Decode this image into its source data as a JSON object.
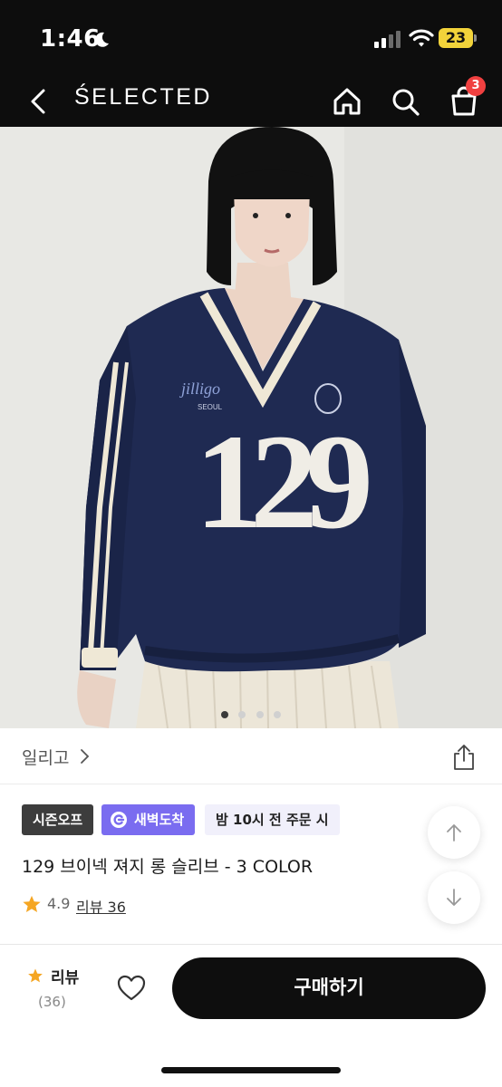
{
  "status_bar": {
    "time": "1:46",
    "battery_level": "23",
    "icons": [
      "moon-icon",
      "signal-icon",
      "wifi-icon",
      "battery-icon"
    ],
    "battery_color": "#f2d33a"
  },
  "nav": {
    "brand": "ŚELECTED",
    "cart_count": "3",
    "icons": [
      "back-arrow-icon",
      "home-icon",
      "search-icon",
      "shopping-bag-icon"
    ],
    "badge_color": "#f04040"
  },
  "hero": {
    "slide_count": 4,
    "active_slide": 1
  },
  "product": {
    "brand_name": "일리고",
    "tags": {
      "season": "시즌오프",
      "dawn_delivery": "새벽도착",
      "delivery_note": "밤 10시 전 주문 시"
    },
    "title": "129 브이넥 져지 롱 슬리브 - 3 COLOR",
    "rating": "4.9",
    "review_link": "리뷰 36",
    "accent_color": "#7a6cf0",
    "star_color": "#f5a623"
  },
  "bottom_bar": {
    "review_label": "리뷰",
    "review_count": "(36)",
    "buy_label": "구매하기"
  }
}
